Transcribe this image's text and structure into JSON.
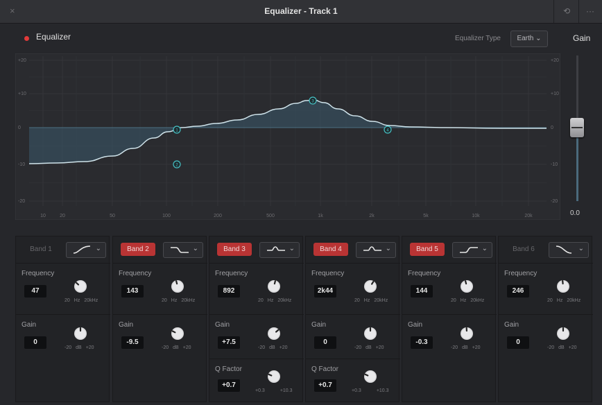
{
  "window": {
    "title": "Equalizer - Track 1",
    "close_glyph": "×",
    "reset_glyph": "⟲",
    "more_glyph": "···"
  },
  "header": {
    "equalizer_label": "Equalizer",
    "eq_type_label": "Equalizer Type",
    "eq_type_value": "Earth",
    "gain_label": "Gain",
    "gain_value": "0.0"
  },
  "graph": {
    "y_left": [
      "+20",
      "+10",
      "0",
      "-10",
      "-20"
    ],
    "y_right": [
      "+20",
      "+10",
      "0",
      "-10",
      "-20"
    ],
    "x_ticks": [
      "10",
      "20",
      "50",
      "100",
      "200",
      "500",
      "1k",
      "2k",
      "5k",
      "10k",
      "20k"
    ],
    "nodes": [
      "1",
      "2",
      "3",
      "4"
    ]
  },
  "bands": [
    {
      "label": "Band 1",
      "active": false,
      "shape": "hipass",
      "frequency": {
        "label": "Frequency",
        "value": "47",
        "scale": [
          "20",
          "Hz",
          "20kHz"
        ]
      },
      "gain": {
        "label": "Gain",
        "value": "0",
        "scale": [
          "-20",
          "dB",
          "+20"
        ]
      }
    },
    {
      "label": "Band 2",
      "active": true,
      "shape": "lowshelf",
      "frequency": {
        "label": "Frequency",
        "value": "143",
        "scale": [
          "20",
          "Hz",
          "20kHz"
        ]
      },
      "gain": {
        "label": "Gain",
        "value": "-9.5",
        "scale": [
          "-20",
          "dB",
          "+20"
        ]
      }
    },
    {
      "label": "Band 3",
      "active": true,
      "shape": "bell",
      "frequency": {
        "label": "Frequency",
        "value": "892",
        "scale": [
          "20",
          "Hz",
          "20kHz"
        ]
      },
      "gain": {
        "label": "Gain",
        "value": "+7.5",
        "scale": [
          "-20",
          "dB",
          "+20"
        ]
      },
      "q": {
        "label": "Q Factor",
        "value": "+0.7",
        "scale": [
          "+0.3",
          "+10.3"
        ]
      }
    },
    {
      "label": "Band 4",
      "active": true,
      "shape": "bell",
      "frequency": {
        "label": "Frequency",
        "value": "2k44",
        "scale": [
          "20",
          "Hz",
          "20kHz"
        ]
      },
      "gain": {
        "label": "Gain",
        "value": "0",
        "scale": [
          "-20",
          "dB",
          "+20"
        ]
      },
      "q": {
        "label": "Q Factor",
        "value": "+0.7",
        "scale": [
          "+0.3",
          "+10.3"
        ]
      }
    },
    {
      "label": "Band 5",
      "active": true,
      "shape": "highshelf",
      "frequency": {
        "label": "Frequency",
        "value": "144",
        "scale": [
          "20",
          "Hz",
          "20kHz"
        ]
      },
      "gain": {
        "label": "Gain",
        "value": "-0.3",
        "scale": [
          "-20",
          "dB",
          "+20"
        ]
      }
    },
    {
      "label": "Band 6",
      "active": false,
      "shape": "lowpass",
      "frequency": {
        "label": "Frequency",
        "value": "246",
        "scale": [
          "20",
          "Hz",
          "20kHz"
        ]
      },
      "gain": {
        "label": "Gain",
        "value": "0",
        "scale": [
          "-20",
          "dB",
          "+20"
        ]
      }
    }
  ],
  "colors": {
    "accent": "#45c1c4",
    "band_active": "#b93434",
    "curve": "#cfe3ea"
  }
}
